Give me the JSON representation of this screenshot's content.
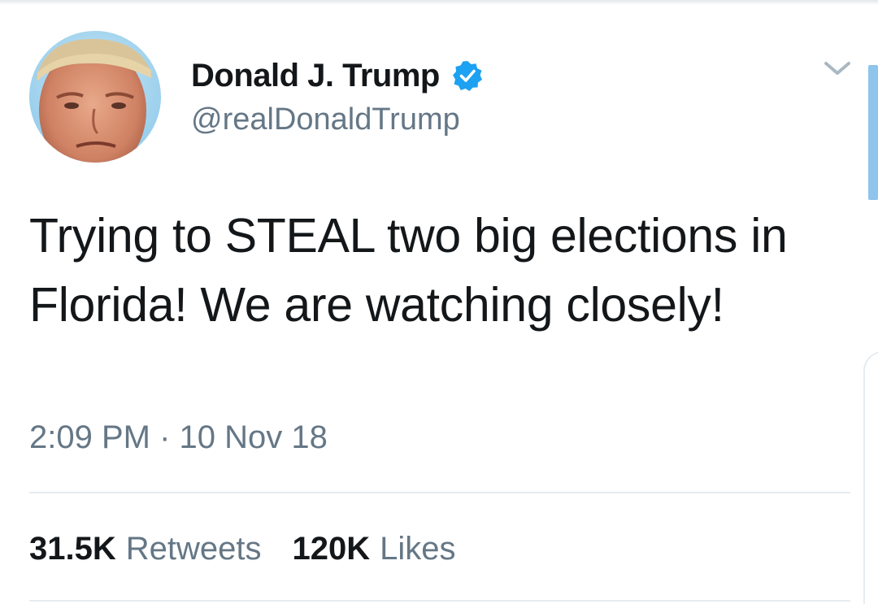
{
  "author": {
    "display_name": "Donald J. Trump",
    "handle": "@realDonaldTrump",
    "verified": true,
    "avatar_icon": "profile-photo"
  },
  "tweet": {
    "text": "Trying to STEAL two big elections in Florida! We are watching closely!",
    "timestamp": "2:09 PM · 10 Nov 18"
  },
  "stats": {
    "retweets_count": "31.5K",
    "retweets_label": "Retweets",
    "likes_count": "120K",
    "likes_label": "Likes"
  },
  "icons": {
    "verified": "verified-badge-icon",
    "menu": "chevron-down-icon"
  },
  "colors": {
    "verified_blue": "#1da1f2",
    "text_primary": "#14171a",
    "text_secondary": "#657786",
    "divider": "#e6ecf0",
    "scrollbar": "#8fc4ec"
  }
}
